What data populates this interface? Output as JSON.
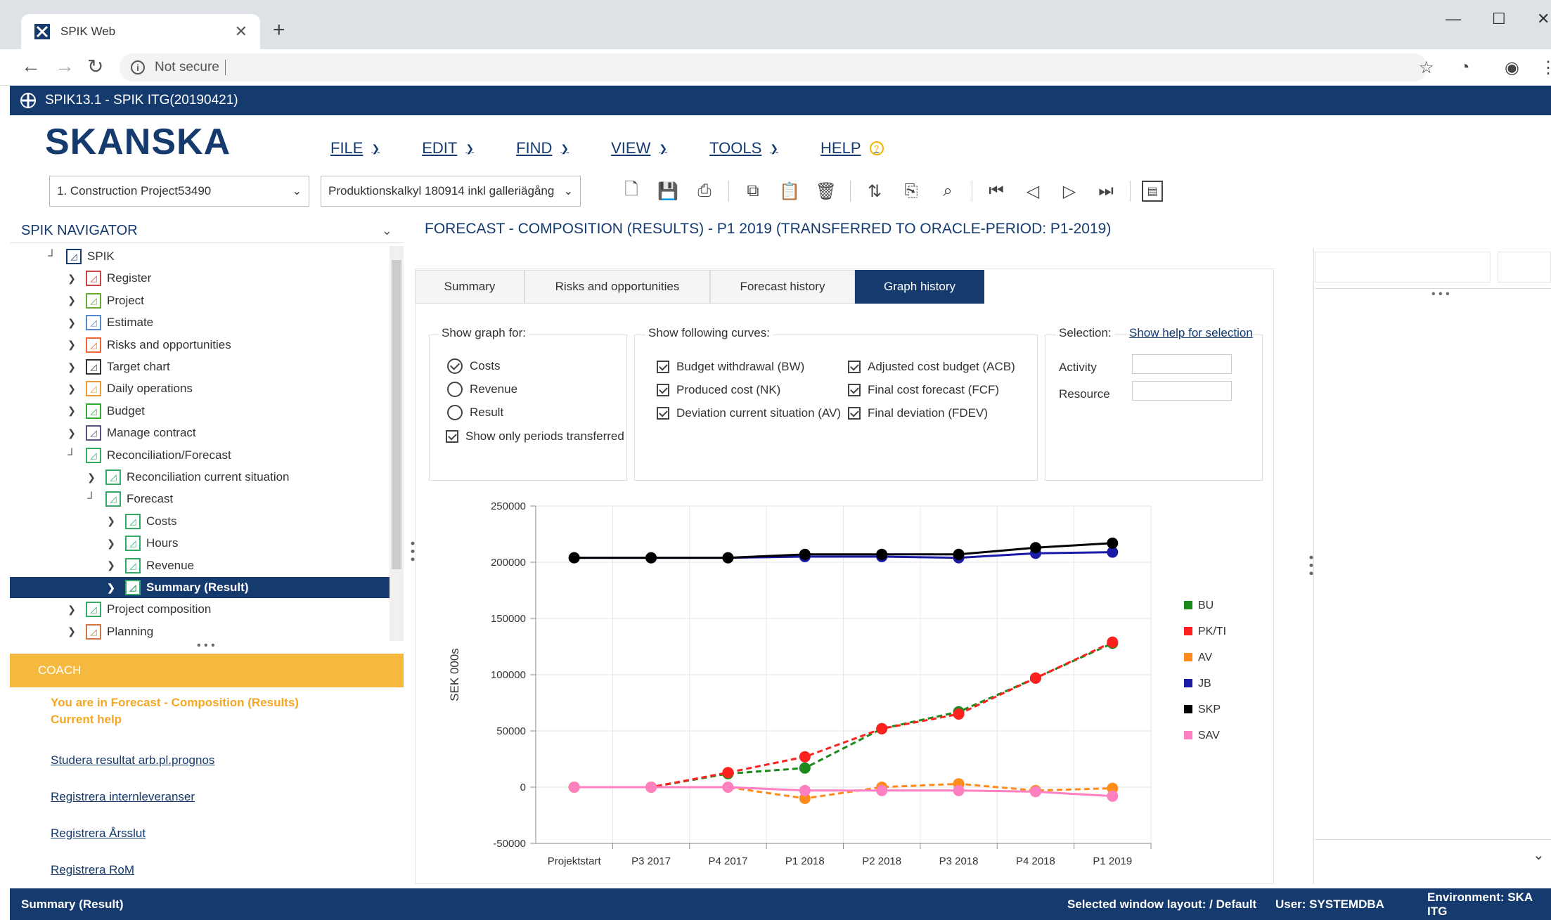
{
  "browser": {
    "tab_title": "SPIK Web",
    "address": "Not secure"
  },
  "app": {
    "title": "SPIK13.1 - SPIK ITG(20190421)",
    "logo": "SKANSKA"
  },
  "menu": {
    "file": "FILE",
    "edit": "EDIT",
    "find": "FIND",
    "view": "VIEW",
    "tools": "TOOLS",
    "help": "HELP"
  },
  "selectors": {
    "project": "1. Construction Project53490",
    "calc": "Produktionskalkyl 180914 inkl galleriägång"
  },
  "navigator": {
    "title": "SPIK NAVIGATOR",
    "items": [
      {
        "label": "SPIK",
        "indent": 0,
        "expander": "┘"
      },
      {
        "label": "Register",
        "indent": 1,
        "expander": "›"
      },
      {
        "label": "Project",
        "indent": 1,
        "expander": "›"
      },
      {
        "label": "Estimate",
        "indent": 1,
        "expander": "›"
      },
      {
        "label": "Risks and opportunities",
        "indent": 1,
        "expander": "›"
      },
      {
        "label": "Target chart",
        "indent": 1,
        "expander": "›"
      },
      {
        "label": "Daily operations",
        "indent": 1,
        "expander": "›"
      },
      {
        "label": "Budget",
        "indent": 1,
        "expander": "›"
      },
      {
        "label": "Manage contract",
        "indent": 1,
        "expander": "›"
      },
      {
        "label": "Reconciliation/Forecast",
        "indent": 1,
        "expander": "┘"
      },
      {
        "label": "Reconciliation current situation",
        "indent": 2,
        "expander": "›"
      },
      {
        "label": "Forecast",
        "indent": 2,
        "expander": "┘"
      },
      {
        "label": "Costs",
        "indent": 3,
        "expander": "›"
      },
      {
        "label": "Hours",
        "indent": 3,
        "expander": "›"
      },
      {
        "label": "Revenue",
        "indent": 3,
        "expander": "›"
      },
      {
        "label": "Summary (Result)",
        "indent": 3,
        "expander": "›",
        "selected": true
      },
      {
        "label": "Project composition",
        "indent": 1,
        "expander": "›"
      },
      {
        "label": "Planning",
        "indent": 1,
        "expander": "›"
      }
    ]
  },
  "coach": {
    "title": "COACH",
    "note1": "You are in Forecast - Composition (Results)",
    "note2": "Current help",
    "links": [
      "Studera resultat arb.pl.prognos",
      "Registrera internleveranser",
      "Registrera Årsslut",
      "Registrera RoM"
    ]
  },
  "main": {
    "title": "FORECAST - COMPOSITION (RESULTS) - P1 2019 (TRANSFERRED TO ORACLE-PERIOD: P1-2019)",
    "tabs": [
      "Summary",
      "Risks and opportunities",
      "Forecast history",
      "Graph history"
    ],
    "active_tab": 3,
    "show_graph_for": {
      "legend": "Show graph for:",
      "options": [
        "Costs",
        "Revenue",
        "Result"
      ],
      "selected": 0,
      "checkbox": "Show only periods transferred"
    },
    "curves": {
      "legend": "Show following curves:",
      "items": [
        "Budget withdrawal (BW)",
        "Produced cost (NK)",
        "Deviation current situation (AV)",
        "Adjusted cost budget (ACB)",
        "Final cost forecast (FCF)",
        "Final deviation (FDEV)"
      ]
    },
    "selection": {
      "legend": "Selection:",
      "help_link": "Show help for selection",
      "activity": "Activity",
      "resource": "Resource"
    }
  },
  "chart_data": {
    "type": "line",
    "ylabel": "SEK 000s",
    "xlabel": "",
    "categories": [
      "Projektstart",
      "P3 2017",
      "P4 2017",
      "P1 2018",
      "P2 2018",
      "P3 2018",
      "P4 2018",
      "P1 2019"
    ],
    "ylim": [
      -50000,
      250000
    ],
    "yticks": [
      -50000,
      0,
      50000,
      100000,
      150000,
      200000,
      250000
    ],
    "grid": true,
    "legend_position": "right",
    "series": [
      {
        "name": "BU",
        "color": "#1a8a1a",
        "dashed": true,
        "values": [
          0,
          0,
          12000,
          17000,
          52000,
          67000,
          97000,
          128000
        ]
      },
      {
        "name": "PK/TI",
        "color": "#ff2020",
        "dashed": true,
        "values": [
          0,
          0,
          13000,
          27000,
          52000,
          65000,
          97000,
          129000
        ]
      },
      {
        "name": "AV",
        "color": "#ff8c1a",
        "dashed": true,
        "values": [
          0,
          0,
          0,
          -10000,
          0,
          3000,
          -3000,
          -1000
        ]
      },
      {
        "name": "JB",
        "color": "#1a1aa6",
        "dashed": false,
        "values": [
          204000,
          204000,
          204000,
          205000,
          205000,
          204000,
          208000,
          209000
        ]
      },
      {
        "name": "SKP",
        "color": "#000000",
        "dashed": false,
        "values": [
          204000,
          204000,
          204000,
          207000,
          207000,
          207000,
          213000,
          217000
        ]
      },
      {
        "name": "SAV",
        "color": "#ff80c0",
        "dashed": false,
        "values": [
          0,
          0,
          0,
          -3000,
          -3000,
          -3000,
          -4000,
          -8000
        ]
      }
    ]
  },
  "status": {
    "left": "Summary (Result)",
    "layout": "Selected window layout: / Default",
    "user": "User: SYSTEMDBA",
    "env": "Environment: SKA ITG"
  }
}
